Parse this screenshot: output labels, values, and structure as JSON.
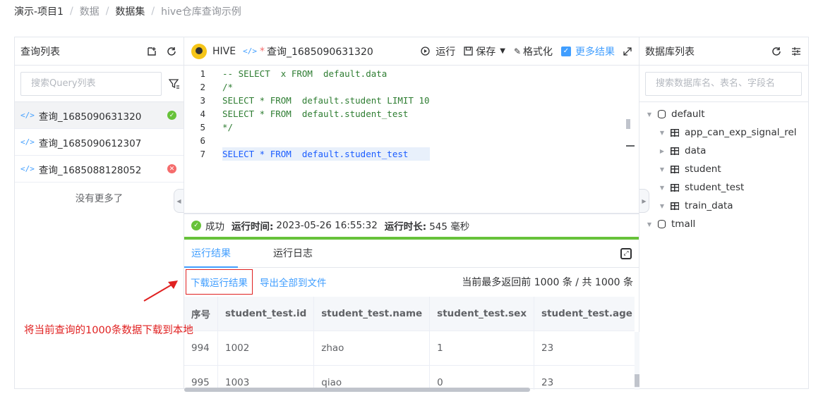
{
  "breadcrumb": [
    "演示-项目1",
    "数据",
    "数据集",
    "hive仓库查询示例"
  ],
  "query_list": {
    "title": "查询列表",
    "search_placeholder": "搜索Query列表",
    "items": [
      {
        "name": "查询_1685090631320",
        "status": "success"
      },
      {
        "name": "查询_1685090612307",
        "status": ""
      },
      {
        "name": "查询_1685088128052",
        "status": "error"
      }
    ],
    "no_more": "没有更多了"
  },
  "editor": {
    "engine": "HIVE",
    "tab_name": "查询_1685090631320",
    "toolbar": {
      "run": "运行",
      "save": "保存",
      "format": "格式化",
      "more_results": "更多结果"
    },
    "line_numbers": [
      "1",
      "2",
      "3",
      "4",
      "5",
      "6",
      "7"
    ],
    "code_lines": [
      "-- SELECT  x FROM  default.data",
      "/*",
      "SELECT * FROM  default.student LIMIT 10",
      "SELECT * FROM  default.student_test",
      "*/",
      "",
      "SELECT * FROM  default.student_test"
    ]
  },
  "status": {
    "text": "成功",
    "run_time_label": "运行时间:",
    "run_time": "2023-05-26 16:55:32",
    "duration_label": "运行时长:",
    "duration": "545 毫秒"
  },
  "result_tabs": [
    "运行结果",
    "运行日志"
  ],
  "result_tools": {
    "download": "下载运行结果",
    "export": "导出全部到文件",
    "count": "当前最多返回前 1000 条 / 共 1000 条"
  },
  "table": {
    "columns": [
      "序号",
      "student_test.id",
      "student_test.name",
      "student_test.sex",
      "student_test.age"
    ],
    "rows": [
      [
        "994",
        "1002",
        "zhao",
        "1",
        "23"
      ],
      [
        "995",
        "1003",
        "qiao",
        "0",
        "23"
      ]
    ]
  },
  "db_list": {
    "title": "数据库列表",
    "search_placeholder": "搜索数据库名、表名、字段名",
    "tree": [
      {
        "name": "default",
        "type": "db",
        "expanded": true,
        "children": [
          "app_can_exp_signal_rel",
          "data",
          "student",
          "student_test",
          "train_data"
        ]
      },
      {
        "name": "tmall",
        "type": "db",
        "expanded": false
      }
    ]
  },
  "annotation": "将当前查询的1000条数据下载到本地",
  "colors": {
    "accent": "#409eff",
    "success": "#67c23a",
    "error": "#f56c6c",
    "annotation": "#e02020"
  }
}
